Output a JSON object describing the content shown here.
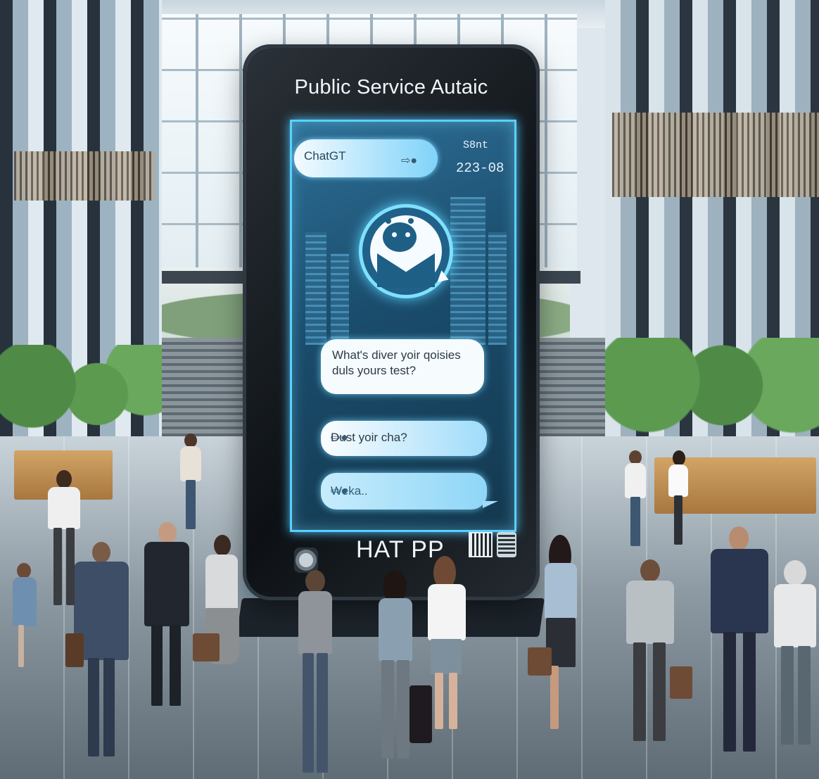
{
  "kiosk": {
    "title": "Public Service Autaic",
    "topbar_label": "ChatGT",
    "stamp_line1": "S8nt",
    "stamp_line2": "223-08",
    "bubble1": "What's diver yoir qoisies duls yours test?",
    "bubble2": "Dust yoir cha?",
    "bubble3": "Weka..",
    "footer_label": "HAT PP",
    "colors": {
      "screen_border": "#5ad0ff",
      "screen_bg": "#1a4c6c",
      "frame": "#0d1115"
    },
    "icons": [
      "robot-avatar-icon",
      "qr-code-icon",
      "emblem-icon",
      "chat-action-icon"
    ]
  }
}
